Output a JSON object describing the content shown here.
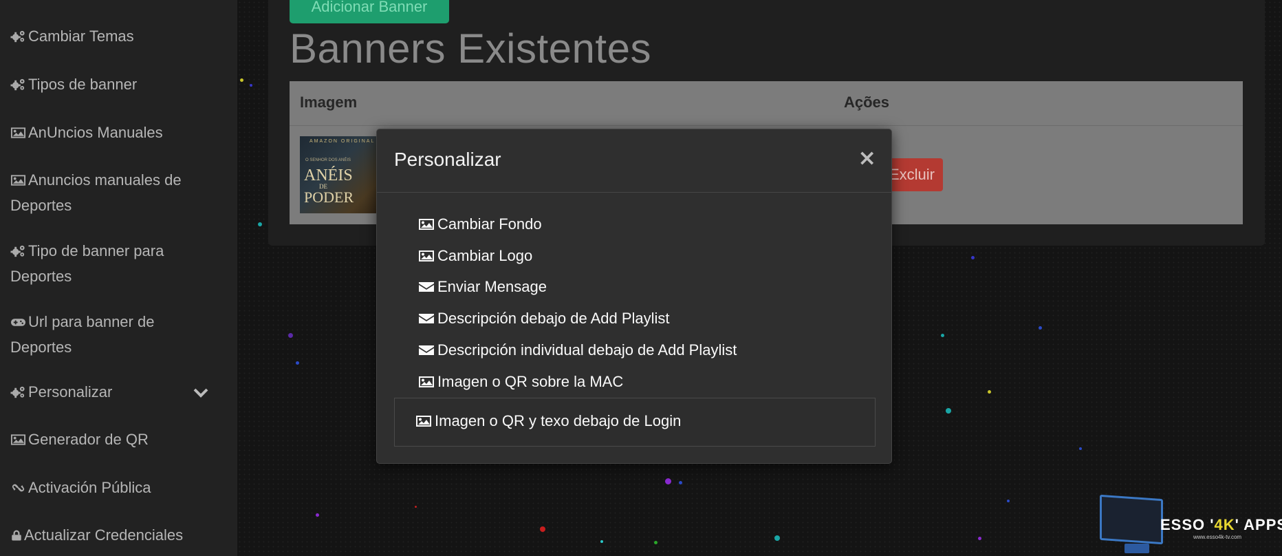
{
  "sidebar": {
    "items": [
      {
        "label": "Cambiar Temas",
        "icon": "cogs-icon"
      },
      {
        "label": "Tipos de banner",
        "icon": "cogs-icon"
      },
      {
        "label": "AnUncios Manuales",
        "icon": "image-icon"
      },
      {
        "label": "Anuncios manuales de Deportes",
        "icon": "image-icon"
      },
      {
        "label": "Tipo de banner para Deportes",
        "icon": "cogs-icon"
      },
      {
        "label": "Url para banner de Deportes",
        "icon": "gamepad-icon"
      },
      {
        "label": "Personalizar",
        "icon": "cogs-icon"
      },
      {
        "label": "Generador de QR",
        "icon": "image-icon"
      },
      {
        "label": "Activación Pública",
        "icon": "link-icon"
      },
      {
        "label": "Actualizar Credenciales",
        "icon": "lock-icon"
      }
    ]
  },
  "main": {
    "add_button": "Adicionar Banner",
    "title": "Banners Existentes",
    "table": {
      "headers": [
        "Imagem",
        "Ações"
      ],
      "rows": [
        {
          "thumbnail": {
            "brand": "AMAZON ORIGINAL",
            "subtitle": "O SENHOR DOS ANÉIS",
            "title_top": "ANÉIS",
            "title_mid": "DE",
            "title_bottom": "PODER"
          },
          "delete_label": "Excluir"
        }
      ]
    }
  },
  "modal": {
    "title": "Personalizar",
    "close": "×",
    "items": [
      {
        "label": "Cambiar Fondo",
        "icon": "image-icon"
      },
      {
        "label": "Cambiar Logo",
        "icon": "image-icon"
      },
      {
        "label": "Enviar Mensage",
        "icon": "envelope-icon"
      },
      {
        "label": "Descripción debajo de Add Playlist",
        "icon": "envelope-icon"
      },
      {
        "label": "Descripción individual debajo de Add Playlist",
        "icon": "envelope-icon"
      },
      {
        "label": "Imagen o QR sobre la MAC",
        "icon": "image-icon"
      },
      {
        "label": "Imagen o QR y texo debajo de Login",
        "icon": "image-icon"
      }
    ]
  },
  "logo": {
    "text_pre": "ESSO '",
    "text_accent": "4K",
    "text_post": "' APPS",
    "url": "www.esso4k-tv.com"
  },
  "colors": {
    "sidebar_bg": "#222222",
    "add_button": "#1e9e6e",
    "delete_button": "#b43a32",
    "modal_bg": "#2f2f2f"
  }
}
